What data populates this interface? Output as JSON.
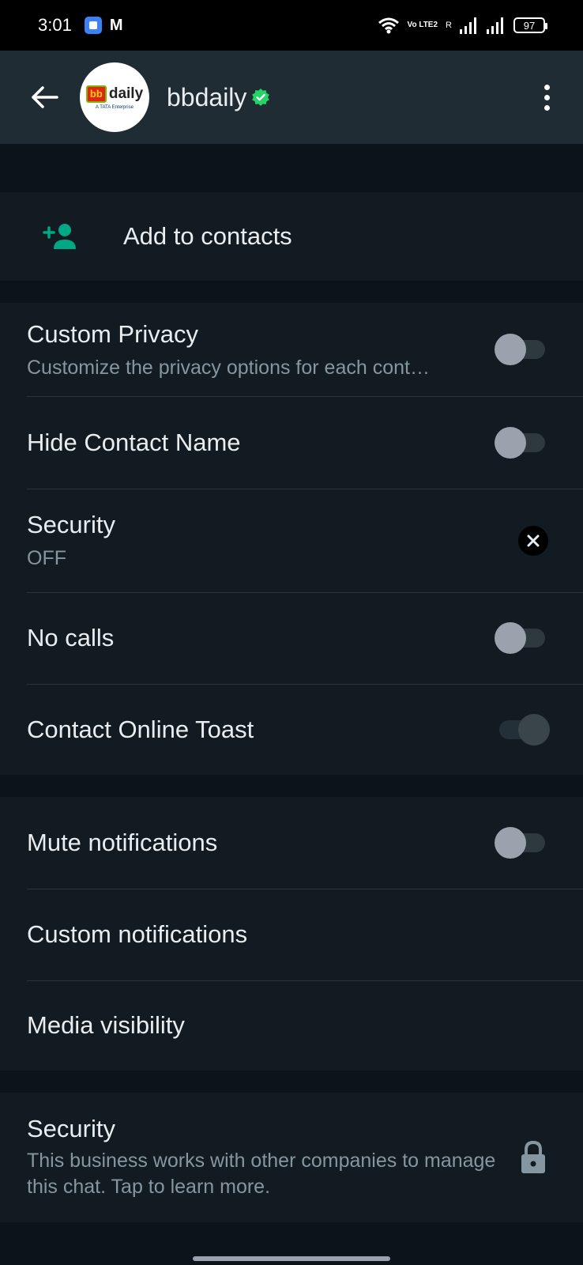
{
  "status_bar": {
    "time": "3:01",
    "app_icons": [
      "app-icon",
      "gmail-icon"
    ],
    "battery": "97",
    "network_label": "Vo LTE2",
    "roaming_label": "R"
  },
  "header": {
    "contact_name": "bbdaily",
    "avatar_logo_text": "daily",
    "avatar_logo_badge": "bb",
    "avatar_tagline": "A TATA Enterprise",
    "verified": true,
    "accent_color": "#25d366"
  },
  "add_contact": {
    "label": "Add to contacts",
    "icon": "add-person-icon"
  },
  "privacy_settings": [
    {
      "title": "Custom Privacy",
      "subtitle": "Customize the privacy options for each cont…",
      "control": "toggle",
      "on": false
    },
    {
      "title": "Hide Contact Name",
      "control": "toggle",
      "on": false
    },
    {
      "title": "Security",
      "subtitle": "OFF",
      "control": "x-circle"
    },
    {
      "title": "No calls",
      "control": "toggle",
      "on": false
    },
    {
      "title": "Contact Online Toast",
      "control": "toggle",
      "on": false,
      "disabled": true
    }
  ],
  "notification_settings": [
    {
      "title": "Mute notifications",
      "control": "toggle",
      "on": false
    },
    {
      "title": "Custom notifications"
    },
    {
      "title": "Media visibility"
    }
  ],
  "security_info": {
    "title": "Security",
    "subtitle": "This business works with other companies to manage this chat. Tap to learn more.",
    "icon": "lock-icon"
  },
  "colors": {
    "background": "#0b141a",
    "surface": "#111b21",
    "header": "#1f2c34",
    "secondary_text": "#8696a0"
  }
}
